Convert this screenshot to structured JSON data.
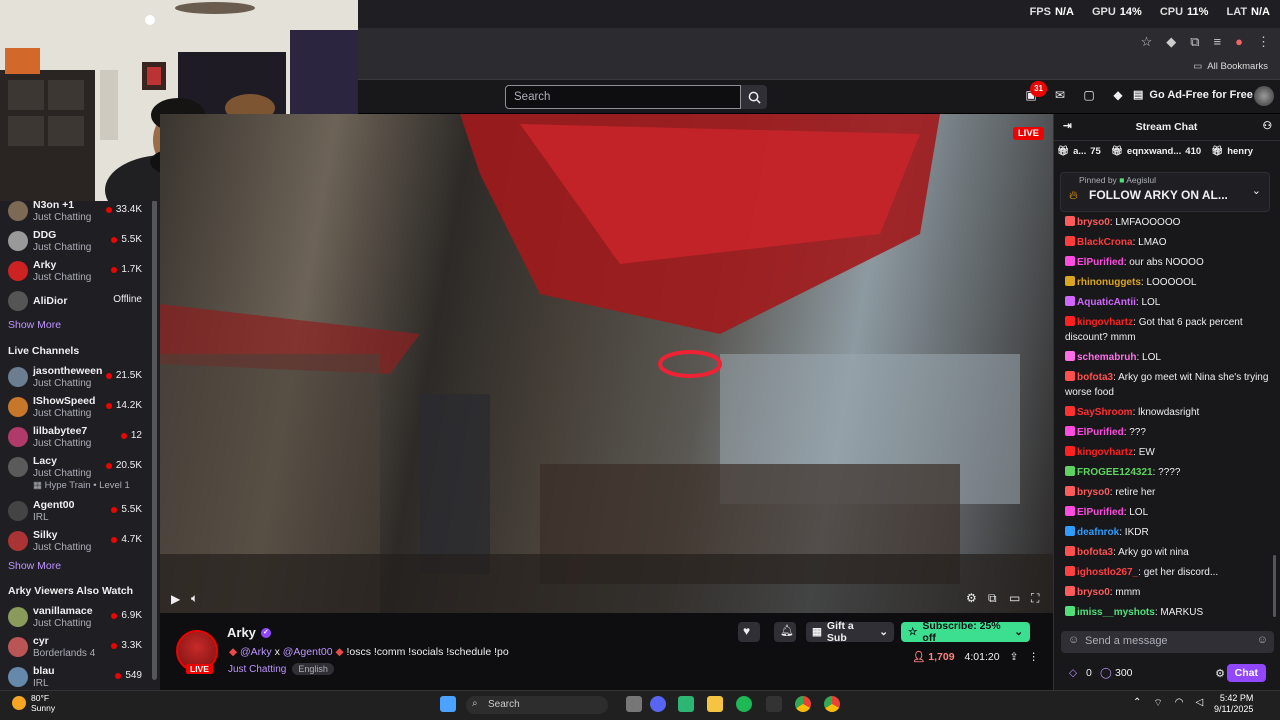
{
  "perf": {
    "fps_label": "FPS",
    "fps": "N/A",
    "gpu_label": "GPU",
    "gpu": "14%",
    "cpu_label": "CPU",
    "cpu": "11%",
    "lat_label": "LAT",
    "lat": "N/A"
  },
  "browser": {
    "bookmarks_label": "All Bookmarks"
  },
  "topnav": {
    "search_placeholder": "Search",
    "notifications_count": "31",
    "ad_free_label": "Go Ad-Free for Free"
  },
  "sidebar": {
    "followed": [
      {
        "name": "N3on +1",
        "category": "Just Chatting",
        "viewers": "33.4K",
        "color": "#7c6a55"
      },
      {
        "name": "DDG",
        "category": "Just Chatting",
        "viewers": "5.5K",
        "color": "#999"
      },
      {
        "name": "Arky",
        "category": "Just Chatting",
        "viewers": "1.7K",
        "color": "#c22"
      },
      {
        "name": "AliDior",
        "category": "",
        "viewers": "Offline",
        "color": "#555"
      }
    ],
    "show_more_1": "Show More",
    "live_header": "Live Channels",
    "live": [
      {
        "name": "jasontheween",
        "category": "Just Chatting",
        "viewers": "21.5K",
        "color": "#6b7d8f"
      },
      {
        "name": "IShowSpeed",
        "category": "Just Chatting",
        "viewers": "14.2K",
        "color": "#c8762a"
      },
      {
        "name": "lilbabytee7",
        "category": "Just Chatting",
        "viewers": "12",
        "color": "#b03a6a"
      },
      {
        "name": "Lacy",
        "category": "Just Chatting",
        "viewers": "20.5K",
        "color": "#5a5a5a",
        "extra": "Hype Train • Level 1"
      },
      {
        "name": "Agent00",
        "category": "IRL",
        "viewers": "5.5K",
        "color": "#444"
      },
      {
        "name": "Silky",
        "category": "Just Chatting",
        "viewers": "4.7K",
        "color": "#a33"
      }
    ],
    "show_more_2": "Show More",
    "also_header": "Arky Viewers Also Watch",
    "also": [
      {
        "name": "vanillamace",
        "category": "Just Chatting",
        "viewers": "6.9K",
        "color": "#8a9a5b"
      },
      {
        "name": "cyr",
        "category": "Borderlands 4",
        "viewers": "3.3K",
        "color": "#b55"
      },
      {
        "name": "blau",
        "category": "IRL",
        "viewers": "549",
        "color": "#6688aa"
      }
    ]
  },
  "player": {
    "live_badge": "LIVE"
  },
  "stream": {
    "channel": "Arky",
    "title_mention1": "@Arky",
    "title_x": " x ",
    "title_mention2": "@Agent00",
    "title_cmds": " !oscs !comm !socials !schedule !po",
    "category": "Just Chatting",
    "tag": "English",
    "live_badge": "LIVE",
    "gift_label": "Gift a Sub",
    "subscribe_label": "Subscribe: 25% off",
    "viewers": "1,709",
    "uptime": "4:01:20"
  },
  "chat": {
    "header": "Stream Chat",
    "leaders": [
      {
        "name": "a...",
        "count": "75"
      },
      {
        "name": "eqnxwand...",
        "count": "410"
      },
      {
        "name": "henry",
        "count": ""
      }
    ],
    "pinned_by": "Pinned by",
    "pinned_user": "Aegislul",
    "pinned_text": "FOLLOW ARKY ON AL...",
    "messages": [
      {
        "user": "bryso0",
        "color": "#ff5b5b",
        "text": "LMFAOOOOO"
      },
      {
        "user": "BlackCrona",
        "color": "#ff3b3b",
        "text": "LMAO"
      },
      {
        "user": "ElPurified",
        "color": "#ff4ce0",
        "text": "our abs NOOOO"
      },
      {
        "user": "rhinonuggets",
        "color": "#daa520",
        "text": "LOOOOOL"
      },
      {
        "user": "AquaticAntii",
        "color": "#d066ff",
        "text": "LOL"
      },
      {
        "user": "kingovhartz",
        "color": "#ff2020",
        "text": "Got that 6 pack percent discount? mmm"
      },
      {
        "user": "schemabruh",
        "color": "#ff6ee8",
        "text": "LOL"
      },
      {
        "user": "bofota3",
        "color": "#ff4f4f",
        "text": "Arky go meet wit Nina she's trying worse food"
      },
      {
        "user": "SayShroom",
        "color": "#ff3030",
        "text": "lknowdasright"
      },
      {
        "user": "ElPurified",
        "color": "#ff4ce0",
        "text": "???"
      },
      {
        "user": "kingovhartz",
        "color": "#ff2020",
        "text": "EW"
      },
      {
        "user": "FROGEE124321",
        "color": "#5fd35f",
        "text": "????"
      },
      {
        "user": "bryso0",
        "color": "#ff5b5b",
        "text": "retire her"
      },
      {
        "user": "ElPurified",
        "color": "#ff4ce0",
        "text": "LOL"
      },
      {
        "user": "deafnrok",
        "color": "#2f9cff",
        "text": "IKDR"
      },
      {
        "user": "bofota3",
        "color": "#ff4f4f",
        "text": "Arky go wit nina"
      },
      {
        "user": "ighostlo267_",
        "color": "#ff4040",
        "text": "get her discord..."
      },
      {
        "user": "bryso0",
        "color": "#ff5b5b",
        "text": "mmm"
      },
      {
        "user": "imiss__myshots",
        "color": "#4fe07a",
        "text": "MARKUS"
      }
    ],
    "input_placeholder": "Send a message",
    "bits": "0",
    "points": "300",
    "send_label": "Chat"
  },
  "taskbar": {
    "temp": "80°F",
    "weather": "Sunny",
    "search_placeholder": "Search",
    "time": "5:42 PM",
    "date": "9/11/2025"
  }
}
